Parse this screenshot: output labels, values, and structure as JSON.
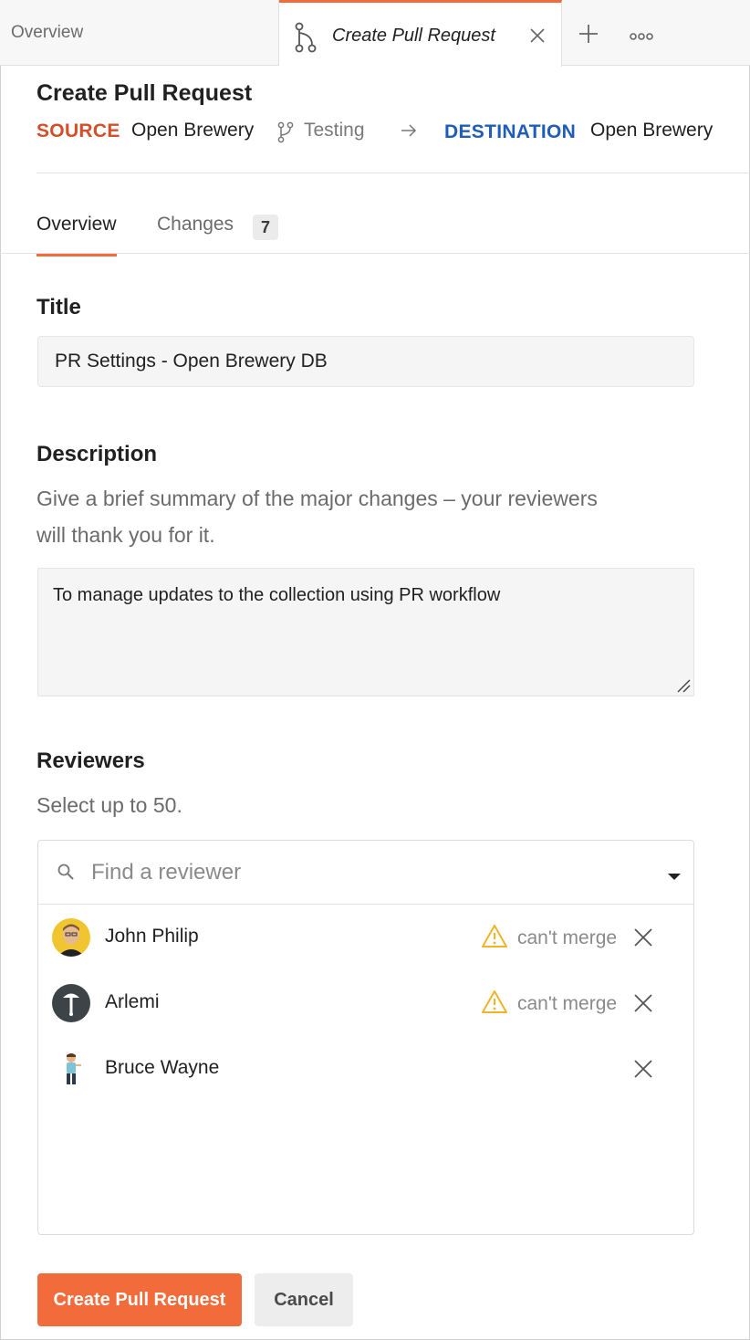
{
  "tabs": {
    "inactive_label": "Overview",
    "active_label": "Create Pull Request",
    "active_icon": "branch-icon",
    "new_tab_icon": "plus-icon",
    "more_icon": "more-icon"
  },
  "header": {
    "title": "Create Pull Request",
    "source_label": "SOURCE",
    "source_value": "Open Brewery",
    "branch_icon": "branch-icon",
    "branch_name": "Testing",
    "arrow": "→",
    "destination_label": "DESTINATION",
    "destination_value": "Open Brewery"
  },
  "subtabs": {
    "overview": "Overview",
    "changes": "Changes",
    "changes_count": "7"
  },
  "form": {
    "title_label": "Title",
    "title_value": "PR Settings - Open Brewery DB",
    "description_label": "Description",
    "description_help_line1": "Give a brief summary of the major changes – your reviewers",
    "description_help_line2": "will thank you for it.",
    "description_value": "To manage updates to the collection using PR workflow",
    "reviewers_label": "Reviewers",
    "reviewers_help": "Select up to 50.",
    "reviewer_search_placeholder": "Find a reviewer"
  },
  "reviewers": [
    {
      "name": "John Philip",
      "status": "can't merge",
      "warning": true
    },
    {
      "name": "Arlemi",
      "status": "can't merge",
      "warning": true
    },
    {
      "name": "Bruce Wayne",
      "status": "",
      "warning": false
    }
  ],
  "actions": {
    "create_label": "Create Pull Request",
    "cancel_label": "Cancel"
  },
  "colors": {
    "accent": "#f26b3a",
    "source": "#d24f2a",
    "destination": "#1f5db8",
    "warning": "#f0b429"
  }
}
